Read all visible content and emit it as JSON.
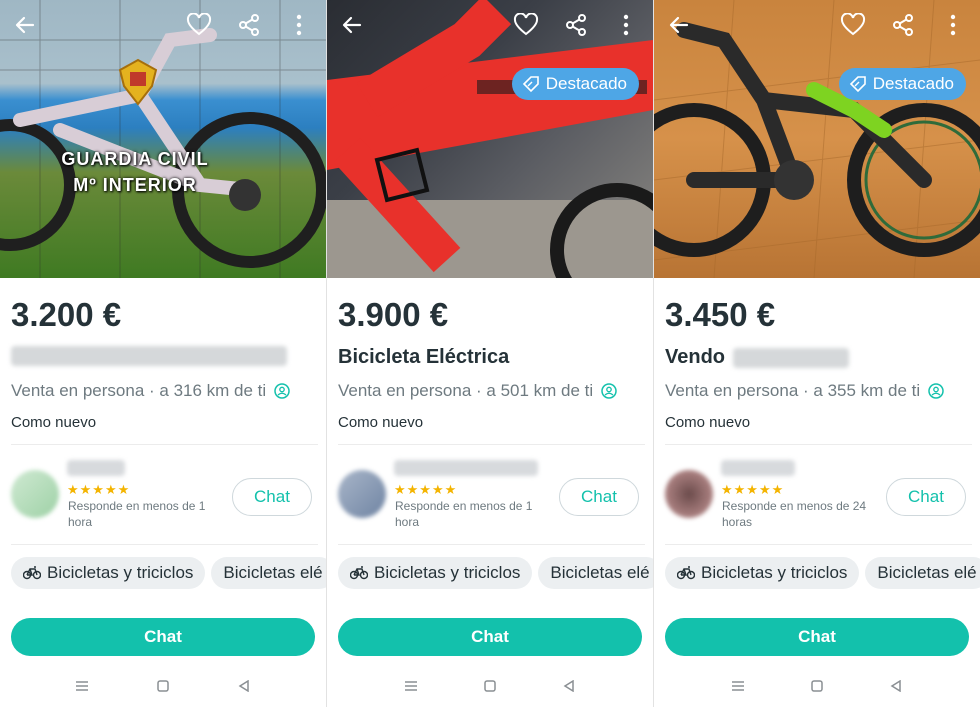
{
  "listings": [
    {
      "price": "3.200 €",
      "title_prefix": "",
      "location": "Venta en persona · a 316 km de ti",
      "condition": "Como nuevo",
      "badge": "",
      "watermark_line1": "GUARDIA CIVIL",
      "watermark_line2": "Mº INTERIOR",
      "stars": "★★★★★",
      "response": "Responde en menos de 1 hora",
      "chat_label": "Chat",
      "chips": [
        "Bicicletas y triciclos",
        "Bicicletas elé"
      ],
      "cta": "Chat"
    },
    {
      "price": "3.900 €",
      "title_prefix": "Bicicleta Eléctrica",
      "location": "Venta en persona · a 501 km de ti",
      "condition": "Como nuevo",
      "badge": "Destacado",
      "stars": "★★★★★",
      "response": "Responde en menos de 1 hora",
      "chat_label": "Chat",
      "chips": [
        "Bicicletas y triciclos",
        "Bicicletas elé"
      ],
      "cta": "Chat"
    },
    {
      "price": "3.450 €",
      "title_prefix": "Vendo",
      "location": "Venta en persona · a 355 km de ti",
      "condition": "Como nuevo",
      "badge": "Destacado",
      "stars": "★★★★★",
      "response": "Responde en menos de 24 horas",
      "chat_label": "Chat",
      "chips": [
        "Bicicletas y triciclos",
        "Bicicletas elé"
      ],
      "cta": "Chat"
    }
  ],
  "icons": {
    "back": "arrow-left-icon",
    "favorite": "heart-icon",
    "share": "share-icon",
    "more": "more-vertical-icon",
    "featured": "tag-icon",
    "verified": "user-verified-icon",
    "category": "bicycle-icon"
  },
  "colors": {
    "brand": "#13c1ac",
    "featured_badge": "#4ea6e6",
    "text": "#253238",
    "muted": "#6e7a80",
    "stars": "#f4b400"
  }
}
